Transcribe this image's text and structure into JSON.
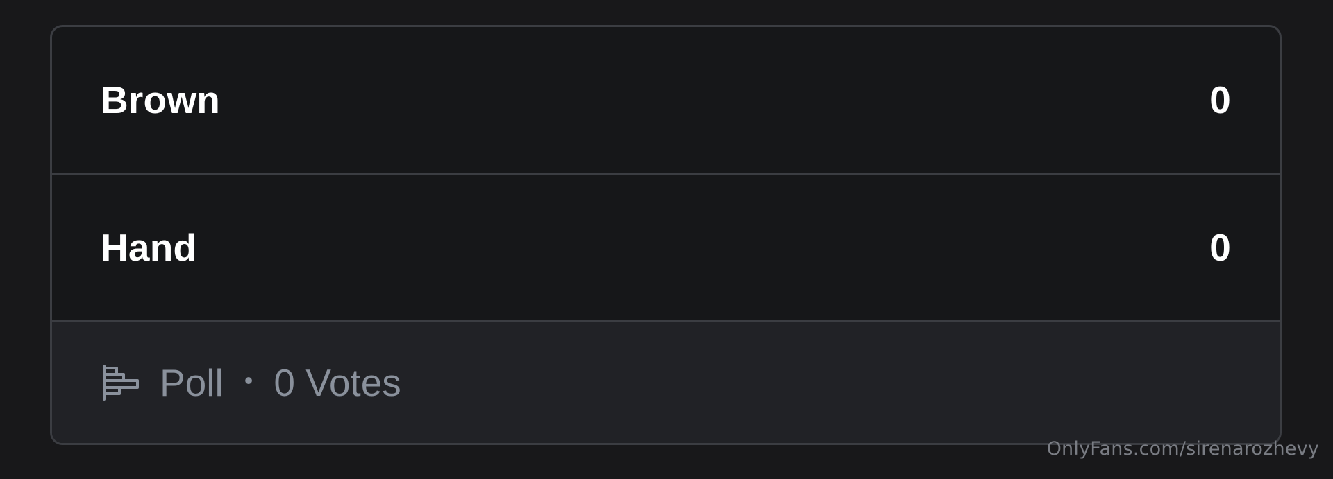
{
  "poll": {
    "options": [
      {
        "label": "Brown",
        "count": "0"
      },
      {
        "label": "Hand",
        "count": "0"
      }
    ],
    "footer": {
      "icon": "poll-bars-icon",
      "type_label": "Poll",
      "separator": "•",
      "votes_label": "0 Votes"
    }
  },
  "watermark": "OnlyFans.com/sirenarozhevy"
}
